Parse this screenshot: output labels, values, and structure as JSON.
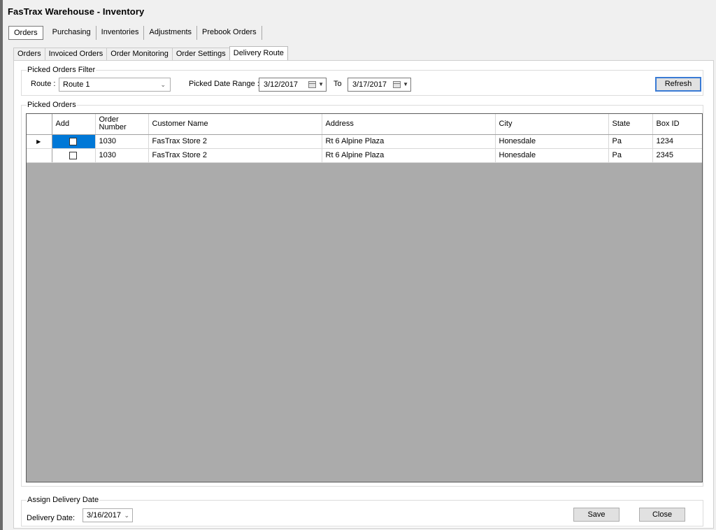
{
  "app": {
    "title": "FasTrax Warehouse - Inventory"
  },
  "main_tabs": [
    "Orders",
    "Purchasing",
    "Inventories",
    "Adjustments",
    "Prebook Orders"
  ],
  "sub_tabs": [
    "Orders",
    "Invoiced Orders",
    "Order Monitoring",
    "Order Settings",
    "Delivery Route"
  ],
  "filter": {
    "legend": "Picked Orders Filter",
    "route_label": "Route :",
    "route_value": "Route 1",
    "range_label": "Picked Date Range :",
    "from_date": "3/12/2017",
    "to_label": "To",
    "to_date": "3/17/2017",
    "refresh_label": "Refresh"
  },
  "picked": {
    "legend": "Picked Orders",
    "columns": [
      "Add",
      "Order Number",
      "Customer Name",
      "Address",
      "City",
      "State",
      "Box ID"
    ],
    "rows": [
      {
        "order": "1030",
        "customer": "FasTrax Store 2",
        "address": "Rt 6 Alpine Plaza",
        "city": "Honesdale",
        "state": "Pa",
        "box": "1234"
      },
      {
        "order": "1030",
        "customer": "FasTrax Store 2",
        "address": "Rt 6 Alpine Plaza",
        "city": "Honesdale",
        "state": "Pa",
        "box": "2345"
      }
    ]
  },
  "assign": {
    "legend": "Assign Delivery Date",
    "label": "Delivery Date:",
    "value": "3/16/2017",
    "save_label": "Save",
    "close_label": "Close"
  },
  "icons": {
    "row_pointer": "row-pointer-icon",
    "dropdown": "chevron-down-icon",
    "calendar": "calendar-icon"
  }
}
